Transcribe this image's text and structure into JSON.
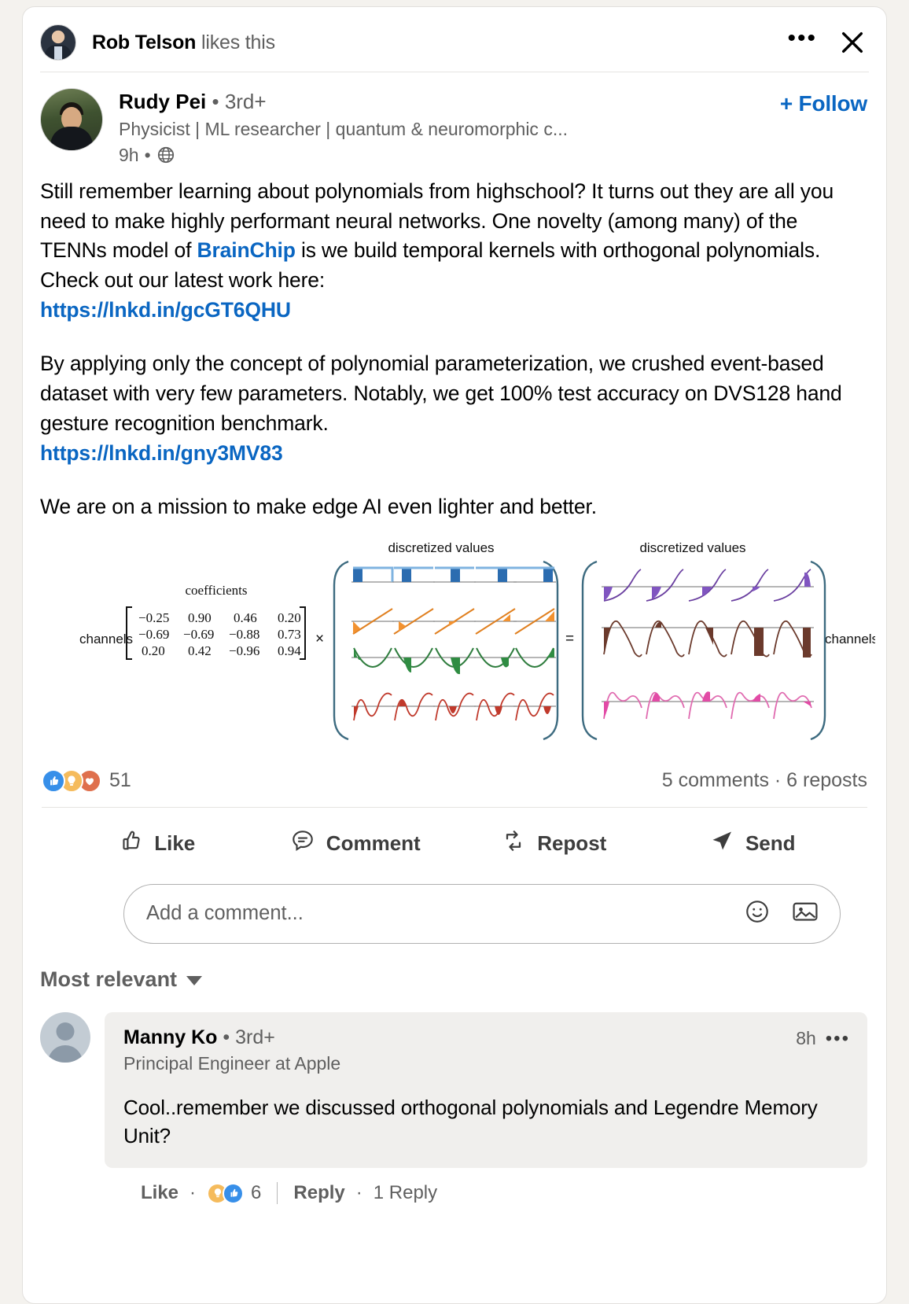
{
  "header": {
    "actor_name": "Rob Telson",
    "action_text": " likes this",
    "more_icon": "ellipsis-icon",
    "close_icon": "close-icon"
  },
  "post": {
    "author": {
      "name": "Rudy Pei",
      "separator": " • ",
      "degree": "3rd+",
      "headline": "Physicist | ML researcher | quantum & neuromorphic c...",
      "time": "9h",
      "time_separator": "•",
      "visibility_icon": "globe-icon"
    },
    "follow_label": "+ Follow",
    "body": {
      "para1_a": "Still remember learning about polynomials from highschool? It turns out they are all you need to make highly performant neural networks. One novelty (among many) of the TENNs model of ",
      "mention": "BrainChip",
      "para1_b": " is we build temporal kernels with orthogonal polynomials. Check out our latest work here:",
      "link1": "https://lnkd.in/gcGT6QHU",
      "para2": "By applying only the concept of polynomial parameterization, we crushed event-based dataset with very few parameters. Notably, we get 100% test accuracy on DVS128 hand gesture recognition benchmark.",
      "link2": "https://lnkd.in/gny3MV83",
      "para3": "We are on a mission to make edge AI even lighter and better."
    },
    "figure": {
      "label_channels_left": "channels",
      "label_channels_right": "channels",
      "label_coefficients": "coefficients",
      "label_discretized_left": "discretized values",
      "label_discretized_right": "discretized values",
      "operator_multiply": "×",
      "operator_equals": "=",
      "matrix": [
        [
          "−0.25",
          "0.90",
          "0.46",
          "0.20"
        ],
        [
          "−0.69",
          "−0.69",
          "−0.88",
          "0.73"
        ],
        [
          "0.20",
          "0.42",
          "−0.96",
          "0.94"
        ]
      ]
    },
    "social": {
      "reaction_icons": [
        "like-icon",
        "insight-icon",
        "love-icon"
      ],
      "reaction_count": "51",
      "comments_reposts": "5 comments · 6 reposts"
    },
    "actions": [
      {
        "label": "Like",
        "icon": "thumbs-up-icon"
      },
      {
        "label": "Comment",
        "icon": "comment-bubble-icon"
      },
      {
        "label": "Repost",
        "icon": "repost-icon"
      },
      {
        "label": "Send",
        "icon": "send-icon"
      }
    ]
  },
  "comment_input": {
    "placeholder": "Add a comment...",
    "emoji_icon": "emoji-icon",
    "image_icon": "image-icon"
  },
  "sort": {
    "label": "Most relevant",
    "caret_icon": "chevron-down-icon"
  },
  "comments": [
    {
      "author_name": "Manny Ko",
      "separator": " • ",
      "degree": "3rd+",
      "headline": "Principal Engineer at Apple",
      "time": "8h",
      "more_icon": "ellipsis-icon",
      "text": "Cool..remember we discussed orthogonal polynomials and Legendre Memory Unit?",
      "like_label": "Like",
      "dot": "·",
      "reaction_icons": [
        "insight-icon",
        "like-icon"
      ],
      "reaction_count": "6",
      "reply_label": "Reply",
      "replies_label": "1 Reply"
    }
  ],
  "colors": {
    "brand_blue": "#0a66c2",
    "card_bg": "#ffffff",
    "page_bg": "#f4f2ee",
    "muted_text": "#5f5f5f",
    "comment_bg": "#f0efed"
  }
}
